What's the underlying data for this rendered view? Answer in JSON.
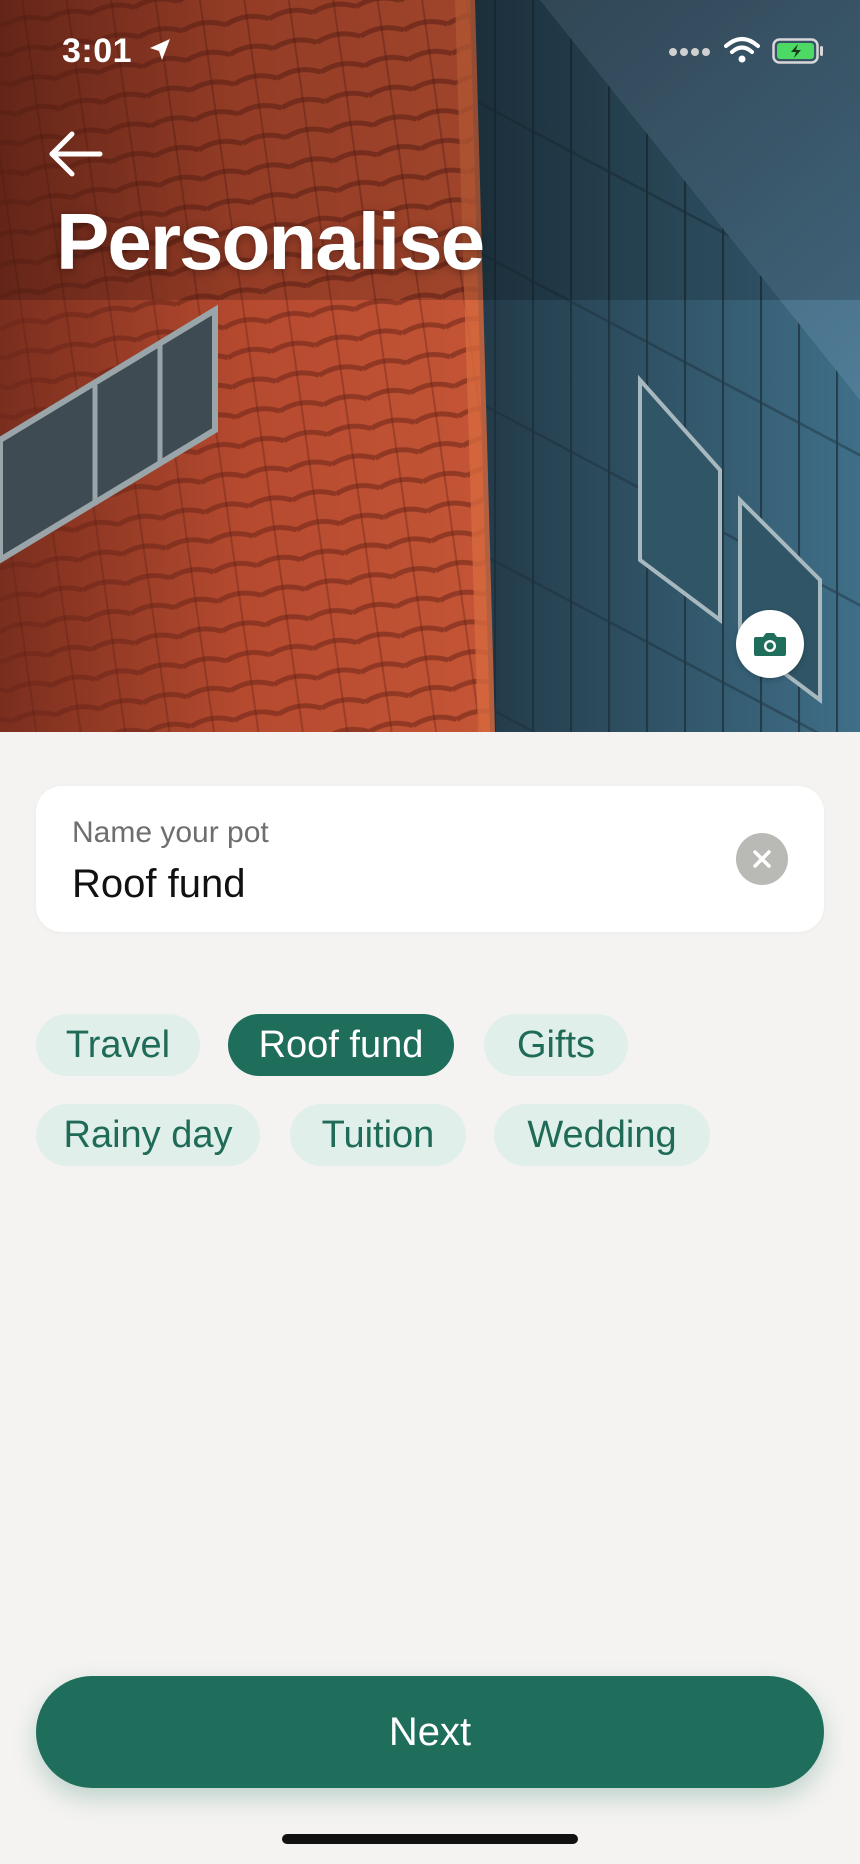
{
  "status_bar": {
    "time": "3:01"
  },
  "header": {
    "title": "Personalise"
  },
  "name_field": {
    "label": "Name your pot",
    "value": "Roof fund"
  },
  "suggestions": [
    {
      "label": "Travel",
      "selected": false
    },
    {
      "label": "Roof fund",
      "selected": true
    },
    {
      "label": "Gifts",
      "selected": false
    },
    {
      "label": "Rainy day",
      "selected": false
    },
    {
      "label": "Tuition",
      "selected": false
    },
    {
      "label": "Wedding",
      "selected": false
    }
  ],
  "footer": {
    "next_label": "Next"
  },
  "colors": {
    "accent": "#1f6e5c",
    "chip_bg": "#e1efeb",
    "page_bg": "#f4f3f1"
  },
  "icons": {
    "back": "arrow-left-icon",
    "camera": "camera-icon",
    "clear": "close-icon",
    "location": "location-arrow-icon",
    "wifi": "wifi-icon",
    "battery": "battery-charging-icon"
  }
}
